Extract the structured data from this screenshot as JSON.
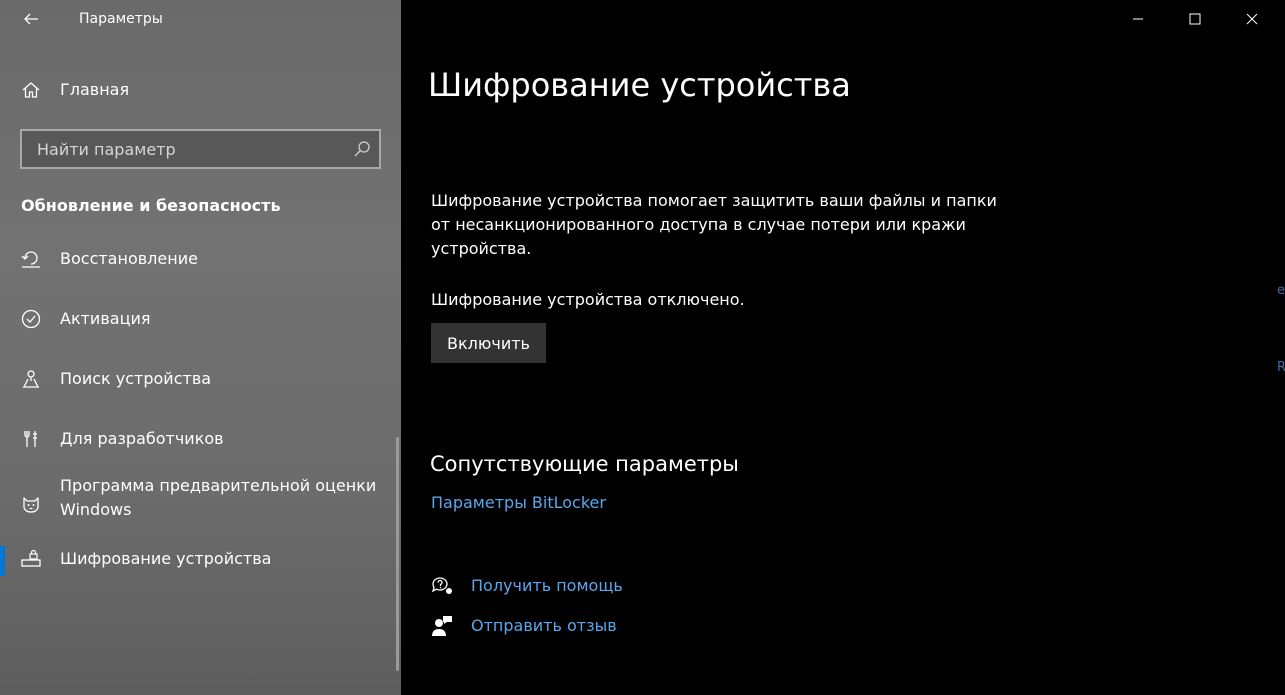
{
  "window": {
    "app_title": "Параметры"
  },
  "sidebar": {
    "home_label": "Главная",
    "search_placeholder": "Найти параметр",
    "section_title": "Обновление и безопасность",
    "items": [
      {
        "label": "Восстановление",
        "icon": "recovery-icon"
      },
      {
        "label": "Активация",
        "icon": "activation-check-icon"
      },
      {
        "label": "Поиск устройства",
        "icon": "find-device-icon"
      },
      {
        "label": "Для разработчиков",
        "icon": "developer-tools-icon"
      },
      {
        "label": "Программа предварительной оценки Windows",
        "icon": "insider-cat-icon"
      },
      {
        "label": "Шифрование устройства",
        "icon": "device-encryption-icon",
        "selected": true
      }
    ]
  },
  "main": {
    "page_title": "Шифрование устройства",
    "description": "Шифрование устройства помогает защитить ваши файлы и папки от несанкционированного доступа в случае потери или кражи устройства.",
    "status": "Шифрование устройства отключено.",
    "enable_button": "Включить",
    "related_title": "Сопутствующие параметры",
    "bitlocker_link": "Параметры BitLocker",
    "help_link": "Получить помощь",
    "feedback_link": "Отправить отзыв"
  },
  "colors": {
    "accent": "#0078d7",
    "link": "#5aa7ec",
    "button_bg": "#333333"
  }
}
